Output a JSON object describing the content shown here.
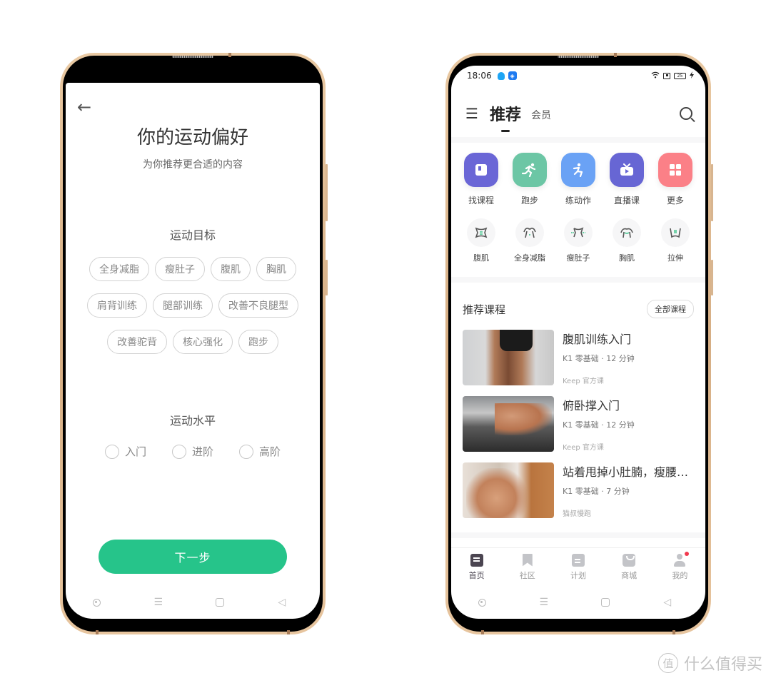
{
  "left_phone": {
    "title": "你的运动偏好",
    "subtitle": "为你推荐更合适的内容",
    "goal_section": {
      "label": "运动目标",
      "rows": [
        [
          "全身减脂",
          "瘦肚子",
          "腹肌",
          "胸肌"
        ],
        [
          "肩背训练",
          "腿部训练",
          "改善不良腿型"
        ],
        [
          "改善驼背",
          "核心强化",
          "跑步"
        ]
      ]
    },
    "level_section": {
      "label": "运动水平",
      "options": [
        "入门",
        "进阶",
        "高阶"
      ]
    },
    "next_button": "下一步",
    "icons": {
      "back": "←"
    }
  },
  "right_phone": {
    "status_bar": {
      "time": "18:06",
      "battery": "25",
      "app_badge": "◈"
    },
    "top_nav": {
      "menu_icon": "☰",
      "active_tab": "推荐",
      "other_tab": "会员"
    },
    "quick_actions": [
      {
        "label": "找课程",
        "icon": "▣",
        "color": "#6a66d6"
      },
      {
        "label": "跑步",
        "icon": "🏃",
        "color": "#6cc6a5"
      },
      {
        "label": "练动作",
        "icon": "⚡",
        "color": "#6aa2f5"
      },
      {
        "label": "直播课",
        "icon": "📺",
        "color": "#6766d4"
      },
      {
        "label": "更多",
        "icon": "⊞",
        "color": "#fb8087"
      }
    ],
    "body_parts": [
      {
        "label": "腹肌"
      },
      {
        "label": "全身减脂"
      },
      {
        "label": "瘦肚子"
      },
      {
        "label": "胸肌"
      },
      {
        "label": "拉伸"
      }
    ],
    "recommended": {
      "title": "推荐课程",
      "all_button": "全部课程",
      "courses": [
        {
          "name": "腹肌训练入门",
          "meta": "K1 零基础 · 12 分钟",
          "source": "Keep 官方课"
        },
        {
          "name": "俯卧撑入门",
          "meta": "K1 零基础 · 12 分钟",
          "source": "Keep 官方课"
        },
        {
          "name": "站着甩掉小肚腩，瘦腰…",
          "meta": "K1 零基础 · 7 分钟",
          "source": "猫叔慢跑"
        }
      ]
    },
    "tab_bar": [
      {
        "label": "首页",
        "active": true
      },
      {
        "label": "社区",
        "active": false
      },
      {
        "label": "计划",
        "active": false
      },
      {
        "label": "商城",
        "active": false
      },
      {
        "label": "我的",
        "active": false,
        "badge": true
      }
    ]
  },
  "system_nav": {
    "menu": "☰",
    "back": "◁"
  },
  "watermark": {
    "logo": "值",
    "text": "什么值得买"
  },
  "colors": {
    "primary_green": "#26c48a",
    "gold_frame": "#dcb58b",
    "tab_active": "#4b4551",
    "badge_red": "#f2394e"
  }
}
